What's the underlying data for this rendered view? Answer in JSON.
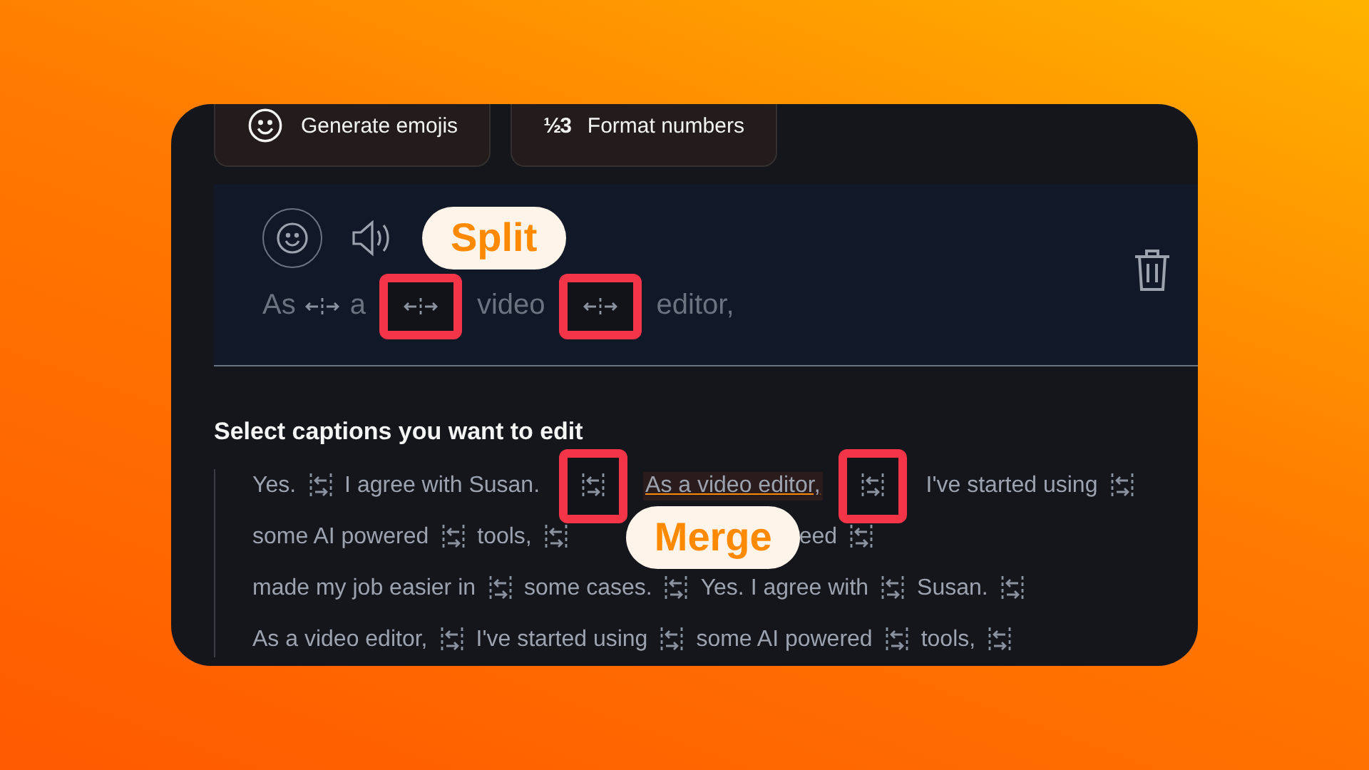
{
  "actions": [
    {
      "kind": "emoji",
      "label": "Generate emojis"
    },
    {
      "kind": "numbers",
      "icon": "½3",
      "label": "Format numbers"
    }
  ],
  "editor": {
    "callout": "Split",
    "tokens": [
      {
        "text": "As",
        "marked": false
      },
      {
        "text": "a",
        "marked": true
      },
      {
        "text": "video",
        "marked": true
      },
      {
        "text": "editor,"
      }
    ]
  },
  "captions": {
    "heading": "Select captions you want to edit",
    "lines": [
      [
        {
          "kind": "text",
          "text": "Yes.",
          "selected": false,
          "marked": false
        },
        {
          "kind": "text",
          "text": "I agree with Susan.",
          "selected": false,
          "marked": true
        },
        {
          "kind": "text",
          "text": "As a video editor,",
          "selected": true,
          "marked": true
        },
        {
          "kind": "text",
          "text": "I've started using",
          "selected": false,
          "marked": false
        }
      ],
      [
        {
          "kind": "text",
          "text": "some AI powered",
          "selected": false,
          "marked": false
        },
        {
          "kind": "text",
          "text": "tools,",
          "selected": false,
          "marked": false
        },
        {
          "kind": "callout",
          "text": "Merge"
        },
        {
          "kind": "text",
          "text": "eed",
          "selected": false,
          "marked": false
        }
      ],
      [
        {
          "kind": "text",
          "text": "made my job easier in",
          "selected": false,
          "marked": false
        },
        {
          "kind": "text",
          "text": "some cases.",
          "selected": false,
          "marked": false
        },
        {
          "kind": "text",
          "text": "Yes. I agree with",
          "selected": false,
          "marked": false
        },
        {
          "kind": "text",
          "text": "Susan.",
          "selected": false,
          "marked": false
        }
      ],
      [
        {
          "kind": "text",
          "text": "As a video editor,",
          "selected": false,
          "marked": false
        },
        {
          "kind": "text",
          "text": "I've started using",
          "selected": false,
          "marked": false
        },
        {
          "kind": "text",
          "text": "some AI powered",
          "selected": false,
          "marked": false
        },
        {
          "kind": "text",
          "text": "tools,",
          "selected": false,
          "marked": false
        }
      ]
    ]
  }
}
